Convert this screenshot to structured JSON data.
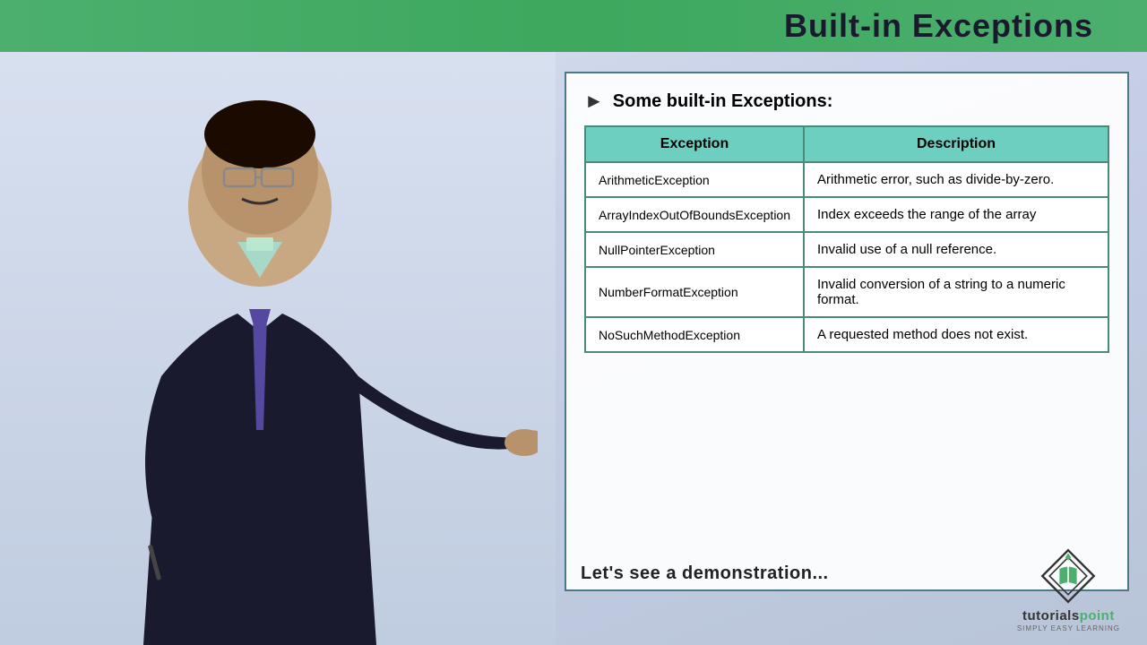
{
  "header": {
    "title": "Built-in Exceptions",
    "top_bar_color": "#4caf6e"
  },
  "slide": {
    "section_header": "Some built-in Exceptions:",
    "table": {
      "columns": [
        "Exception",
        "Description"
      ],
      "rows": [
        {
          "exception": "ArithmeticException",
          "description": "Arithmetic error, such as divide-by-zero."
        },
        {
          "exception": "ArrayIndexOutOfBoundsException",
          "description": "Index exceeds the range of the array"
        },
        {
          "exception": "NullPointerException",
          "description": "Invalid use of a null reference."
        },
        {
          "exception": "NumberFormatException",
          "description": "Invalid conversion of a string to a numeric format."
        },
        {
          "exception": "NoSuchMethodException",
          "description": "A requested method does not exist."
        }
      ]
    },
    "bottom_text": "Let's see a demonstration..."
  },
  "logo": {
    "brand": "tutorials",
    "brand_accent": "point",
    "tagline": "SIMPLY EASY LEARNING"
  }
}
